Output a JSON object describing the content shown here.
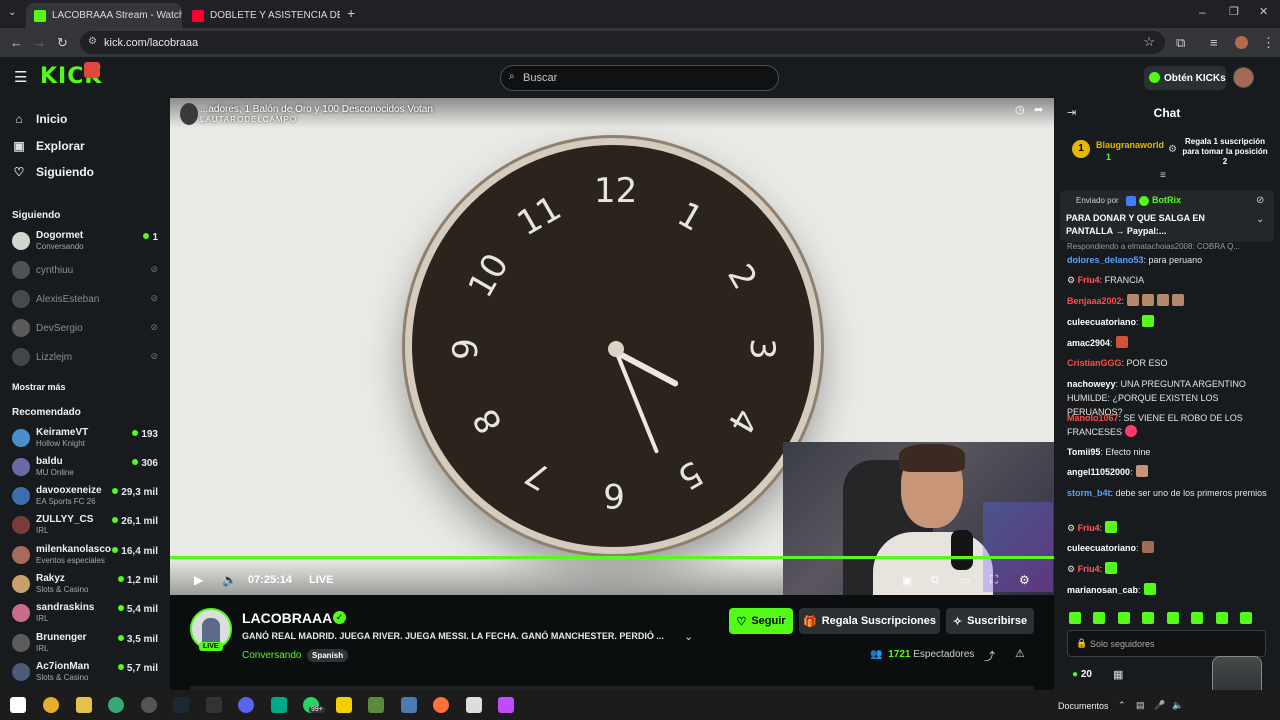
{
  "browser": {
    "tabs": [
      {
        "title": "LACOBRAAA Stream - Watch Li",
        "active": true,
        "favicon_color": "#53fc18"
      },
      {
        "title": "DOBLETE Y ASISTENCIA DE ME",
        "active": false,
        "favicon_color": "#ff0033"
      }
    ],
    "url": "kick.com/lacobraaa"
  },
  "header": {
    "logo": "KICK",
    "search_placeholder": "Buscar",
    "kicks_button": "Obtén KICKs"
  },
  "sidebar": {
    "nav": [
      {
        "label": "Inicio",
        "icon": "home-icon"
      },
      {
        "label": "Explorar",
        "icon": "compass-icon"
      },
      {
        "label": "Siguiendo",
        "icon": "heart-icon"
      }
    ],
    "following_title": "Siguiendo",
    "following": [
      {
        "name": "Dogormet",
        "sub": "Conversando",
        "viewers": "1",
        "online": true
      },
      {
        "name": "cynthiuu",
        "online": false
      },
      {
        "name": "AlexisEsteban",
        "online": false
      },
      {
        "name": "DevSergio",
        "online": false
      },
      {
        "name": "Lizzlejm",
        "online": false
      }
    ],
    "show_more": "Mostrar más",
    "recommended_title": "Recomendado",
    "recommended": [
      {
        "name": "KeirameVT",
        "sub": "Hollow Knight",
        "viewers": "193"
      },
      {
        "name": "baldu",
        "sub": "MU Online",
        "viewers": "306"
      },
      {
        "name": "davooxeneize",
        "sub": "EA Sports FC 26",
        "viewers": "29,3 mil"
      },
      {
        "name": "ZULLYY_CS",
        "sub": "IRL",
        "viewers": "26,1 mil"
      },
      {
        "name": "milenkanolasco",
        "sub": "Eventos especiales",
        "viewers": "16,4 mil"
      },
      {
        "name": "Rakyz",
        "sub": "Slots & Casino",
        "viewers": "1,2 mil"
      },
      {
        "name": "sandraskins",
        "sub": "IRL",
        "viewers": "5,4 mil"
      },
      {
        "name": "Brunenger",
        "sub": "IRL",
        "viewers": "3,5 mil"
      },
      {
        "name": "Ac7ionMan",
        "sub": "Slots & Casino",
        "viewers": "5,7 mil"
      }
    ]
  },
  "video": {
    "overlay_title": "...adores, 1 Balón de Oro y 100 Desconocidos Votan",
    "overlay_sub": "LAUTARODELCAMPO",
    "time": "07:25:14",
    "live_label": "LIVE",
    "clock_numbers": [
      "12",
      "1",
      "2",
      "3",
      "4",
      "5",
      "6",
      "7",
      "8",
      "9",
      "10",
      "11"
    ]
  },
  "stream": {
    "name": "LACOBRAAA",
    "title": "GANÓ REAL MADRID. JUEGA RIVER. JUEGA MESSI. LA FECHA. GANÓ MANCHESTER. PERDIÓ ...",
    "category": "Conversando",
    "language": "Spanish",
    "live_badge": "LIVE",
    "follow_label": "Seguir",
    "gift_label": "Regala Suscripciones",
    "subscribe_label": "Suscribirse",
    "viewer_count": "1721",
    "viewer_label": "Espectadores"
  },
  "chat": {
    "title": "Chat",
    "top_gifter": {
      "name": "Blaugranaworld",
      "count": "1",
      "rank": "1",
      "promo": "Regala 1 suscripción para tomar la posición 2"
    },
    "pinned": {
      "sent_by": "Enviado por",
      "bot": "BotRix",
      "text": "PARA DONAR Y QUE SALGA EN PANTALLA → Paypal:..."
    },
    "reply_note": "Respondiendo a elmatachoias2008: COBRA Q...",
    "messages": [
      {
        "user": "dolores_delano53",
        "color": "#5aa0ff",
        "text": "para peruano"
      },
      {
        "user": "Friu4",
        "color": "#ff5a5a",
        "text": "FRANCIA"
      },
      {
        "user": "Benjaaa2002",
        "color": "#ff4b4b",
        "text": ""
      },
      {
        "user": "culeecuatoriano",
        "color": "#ffffff",
        "text": ""
      },
      {
        "user": "amac2904",
        "color": "#ffffff",
        "text": ""
      },
      {
        "user": "CristianGGG",
        "color": "#ff4b4b",
        "text": "POR ESO"
      },
      {
        "user": "nachoweyy",
        "color": "#ffffff",
        "text": "UNA PREGUNTA ARGENTINO HUMILDE: ¿PORQUE EXISTEN LOS PERUANOS?"
      },
      {
        "user": "Manolo1067",
        "color": "#ff4b4b",
        "text": "SE VIENE EL ROBO DE LOS FRANCESES"
      },
      {
        "user": "Tomii95",
        "color": "#ffffff",
        "text": "Efecto nine"
      },
      {
        "user": "angel11052000",
        "color": "#ffffff",
        "text": ""
      },
      {
        "user": "storm_b4t",
        "color": "#5aa0ff",
        "text": "debe ser uno de los primeros premios"
      },
      {
        "user": "Friu4",
        "color": "#ff5a5a",
        "text": ""
      },
      {
        "user": "culeecuatoriano",
        "color": "#ffffff",
        "text": ""
      },
      {
        "user": "Friu4",
        "color": "#ff5a5a",
        "text": ""
      },
      {
        "user": "marianosan_cab",
        "color": "#ffffff",
        "text": ""
      }
    ],
    "input_placeholder": "Solo seguidores",
    "kicks_balance": "20"
  },
  "taskbar": {
    "documents_label": "Documentos",
    "badge": "99+"
  },
  "colors": {
    "accent": "#53fc18",
    "bg": "#0b0e0f",
    "panel": "#181b1d"
  }
}
